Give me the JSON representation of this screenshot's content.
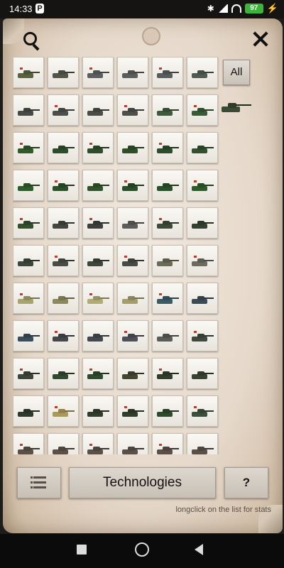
{
  "status": {
    "time": "14:33",
    "app_badge": "P",
    "battery": "97"
  },
  "filters": {
    "all_label": "All"
  },
  "bottom": {
    "technologies_label": "Technologies",
    "help_label": "?",
    "hint": "longclick on the list for stats"
  },
  "units": {
    "columns": 6,
    "colors": [
      [
        "#5a6340",
        "#52574a",
        "#5c5f5f",
        "#5b5d5a",
        "#5a5d5d",
        "#4f5a52"
      ],
      [
        "#474b47",
        "#4d504a",
        "#4a4c48",
        "#4d4f4b",
        "#3f5a3b",
        "#3b5a38"
      ],
      [
        "#2f5a2a",
        "#2c4f29",
        "#2f4c2b",
        "#2e5028",
        "#2b4d2a",
        "#2f512c"
      ],
      [
        "#2f5a2a",
        "#2d4f29",
        "#30532c",
        "#2c4d2a",
        "#2b5029",
        "#2f5a2a"
      ],
      [
        "#33502d",
        "#43463f",
        "#3c3f3c",
        "#5b5d5a",
        "#3d4a39",
        "#31432f"
      ],
      [
        "#3e463b",
        "#4a4c45",
        "#3d473a",
        "#474b44",
        "#6a6c58",
        "#6a6c60"
      ],
      [
        "#a9a36c",
        "#8c8a5a",
        "#b1ac72",
        "#a49e6a",
        "#3a5a66",
        "#3c4b5a"
      ],
      [
        "#3a4d5a",
        "#44464a",
        "#44484e",
        "#4d5058",
        "#5a5c58",
        "#3f4a3f"
      ],
      [
        "#3d453b",
        "#2f4a2c",
        "#2f4a2c",
        "#43472f",
        "#2f3f2b",
        "#374231"
      ],
      [
        "#2f3a2c",
        "#a99a5c",
        "#2f3d2a",
        "#2f3d2a",
        "#2f4a2c",
        "#3d4f3a"
      ],
      [
        "#5a5048",
        "#5a5048",
        "#5a5048",
        "#5a5048",
        "#5a5048",
        "#5a5048"
      ]
    ]
  }
}
